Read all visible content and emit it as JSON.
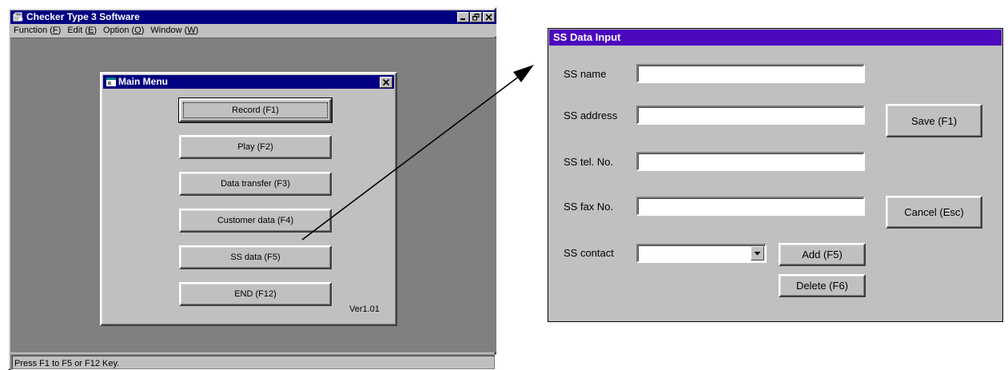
{
  "app": {
    "title": "Checker Type 3 Software",
    "menu": [
      {
        "label": "Function ",
        "key": "F",
        "suffix": ")",
        "prefix": "("
      },
      {
        "label": "Edit ",
        "key": "E",
        "suffix": ")",
        "prefix": "("
      },
      {
        "label": "Option ",
        "key": "O",
        "suffix": ")",
        "prefix": "("
      },
      {
        "label": "Window ",
        "key": "W",
        "suffix": ")",
        "prefix": "("
      }
    ],
    "status": "Press F1 to F5 or F12 Key."
  },
  "main_menu": {
    "title": "Main Menu",
    "buttons": [
      "Record (F1)",
      "Play (F2)",
      "Data transfer (F3)",
      "Customer data (F4)",
      "SS data (F5)",
      "END (F12)"
    ],
    "focused_index": 0,
    "version": "Ver1.01"
  },
  "ss_data_input": {
    "title": "SS Data Input",
    "fields": [
      {
        "label": "SS name",
        "value": ""
      },
      {
        "label": "SS address",
        "value": ""
      },
      {
        "label": "SS tel. No.",
        "value": ""
      },
      {
        "label": "SS fax No.",
        "value": ""
      }
    ],
    "contact": {
      "label": "SS contact",
      "value": ""
    },
    "buttons": {
      "save": "Save (F1)",
      "cancel": "Cancel (Esc)",
      "add": "Add (F5)",
      "delete": "Delete (F6)"
    }
  },
  "colors": {
    "app_titlebar": "#000080",
    "ss_titlebar": "#4b08bd",
    "face": "#c0c0c0",
    "workspace": "#808080"
  },
  "icons": [
    "app-icon",
    "minimize-icon",
    "restore-icon",
    "close-icon",
    "window-icon",
    "dropdown-arrow-icon",
    "pointer-arrow-icon"
  ]
}
